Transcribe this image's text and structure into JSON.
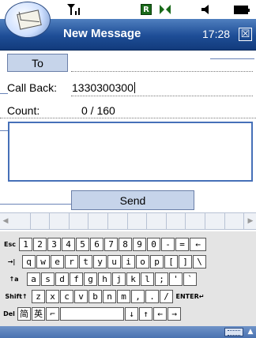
{
  "status_bar": {
    "signal_icon": "signal-strength-icon",
    "badge_text": "R",
    "mic_icon": "microphone-icon",
    "speaker_icon": "speaker-icon",
    "battery_icon": "battery-icon"
  },
  "title_bar": {
    "title": "New Message",
    "time": "17:28",
    "close_glyph": "☒"
  },
  "form": {
    "to_label": "To",
    "callback_label": "Call Back:",
    "callback_value": "1330300300",
    "count_label": "Count:",
    "count_value": "0 / 160",
    "message": "",
    "send_label": "Send"
  },
  "keyboard": {
    "rows": [
      [
        "Esc",
        "1",
        "2",
        "3",
        "4",
        "5",
        "6",
        "7",
        "8",
        "9",
        "0",
        "-",
        "=",
        "←"
      ],
      [
        "→|",
        "q",
        "w",
        "e",
        "r",
        "t",
        "y",
        "u",
        "i",
        "o",
        "p",
        "[",
        "]",
        "\\"
      ],
      [
        "↑a",
        "a",
        "s",
        "d",
        "f",
        "g",
        "h",
        "j",
        "k",
        "l",
        ";",
        "'",
        "`"
      ],
      [
        "Shift↑",
        "z",
        "x",
        "c",
        "v",
        "b",
        "n",
        "m",
        ",",
        ".",
        "/",
        "ENTER↵"
      ],
      [
        "Del",
        "简",
        "英",
        "⌐",
        "",
        "↓",
        "↑",
        "←",
        "→"
      ]
    ]
  },
  "colors": {
    "title_bar": "#1e4d96",
    "button_fill": "#c6d4ea",
    "message_border": "#4670b8"
  }
}
